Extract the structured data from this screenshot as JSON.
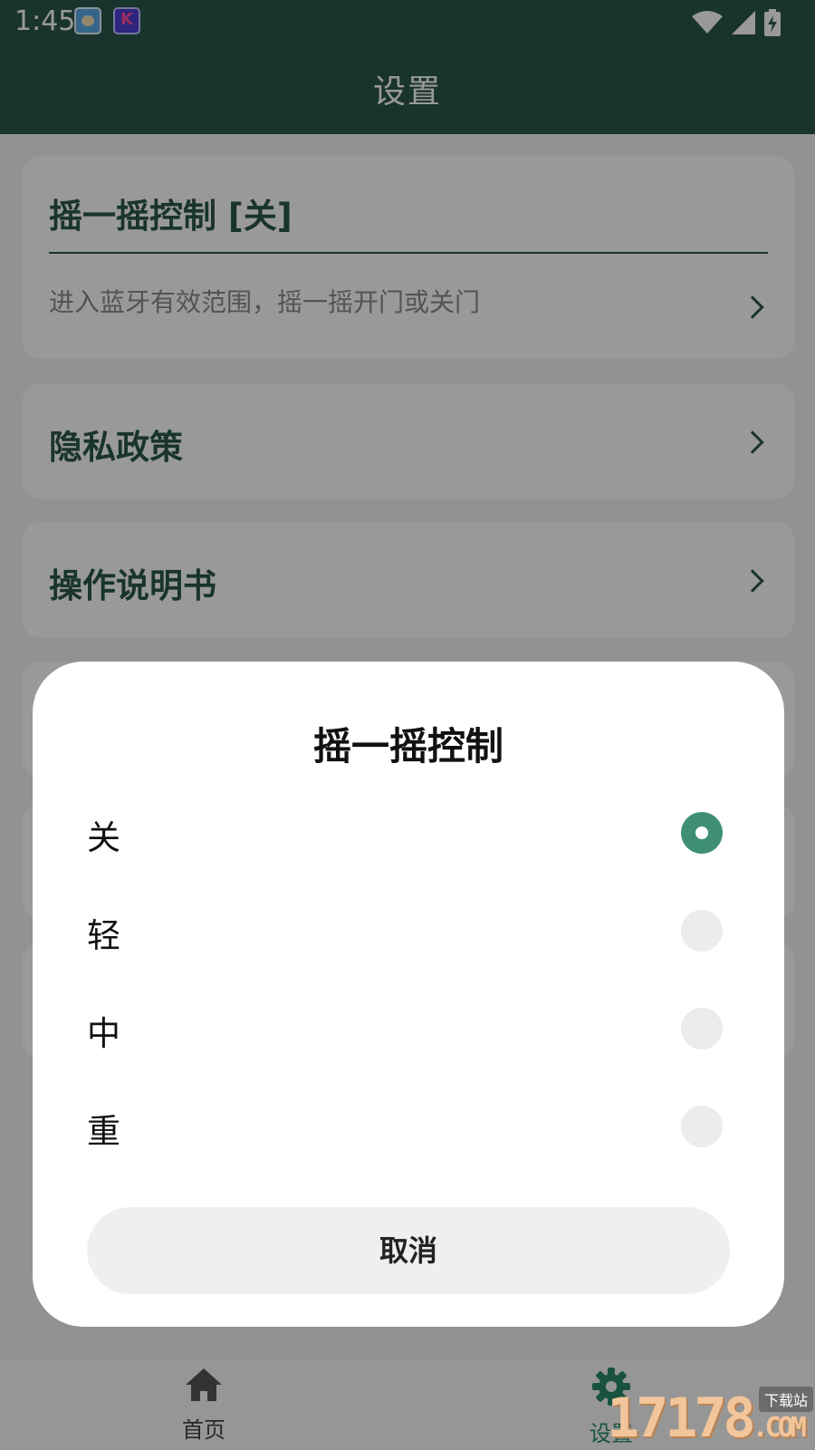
{
  "status_bar": {
    "time": "1:45"
  },
  "header": {
    "title": "设置"
  },
  "settings": {
    "shake": {
      "title": "摇一摇控制 [关]",
      "description": "进入蓝牙有效范围，摇一摇开门或关门"
    },
    "privacy": {
      "title": "隐私政策"
    },
    "manual": {
      "title": "操作说明书"
    }
  },
  "dialog": {
    "title": "摇一摇控制",
    "options": [
      {
        "label": "关",
        "selected": true
      },
      {
        "label": "轻",
        "selected": false
      },
      {
        "label": "中",
        "selected": false
      },
      {
        "label": "重",
        "selected": false
      }
    ],
    "cancel_label": "取消"
  },
  "bottom_nav": {
    "home_label": "首页",
    "settings_label": "设置",
    "active": "settings"
  },
  "watermark": {
    "digits": "17178",
    "suffix": ".COM",
    "tag": "下载站"
  },
  "colors": {
    "primary": "#2b584c",
    "radio_selected": "#3f8f77"
  }
}
